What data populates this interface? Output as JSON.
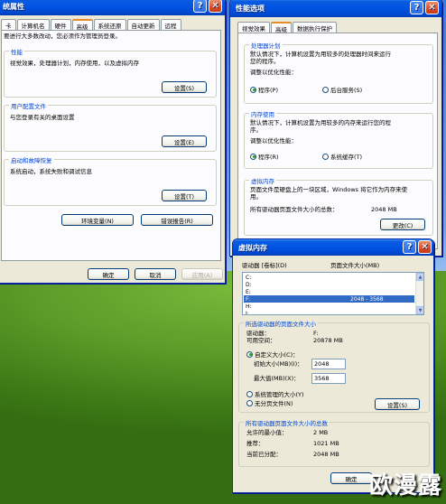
{
  "sysprops": {
    "title": "统属性",
    "help_btn": "?",
    "close_btn": "✕",
    "tabs": [
      "卡",
      "计算机名",
      "硬件",
      "高级",
      "系统还原",
      "自动更新",
      "远程"
    ],
    "admin_note": "要进行大多数改动，您必须作为管理员登录。",
    "performance": {
      "legend": "性能",
      "desc": "视觉效果，处理器计划，内存使用，以及虚拟内存",
      "btn": "设置(S)"
    },
    "profile": {
      "legend": "用户配置文件",
      "desc": "与您登录有关的桌面设置",
      "btn": "设置(E)"
    },
    "startup": {
      "legend": "启动和故障恢复",
      "desc": "系统启动，系统失败和调试信息",
      "btn": "设置(T)"
    },
    "env_btn": "环境变量(N)",
    "error_btn": "错误报告(R)",
    "ok": "确定",
    "cancel": "取消",
    "apply": "应用(A)"
  },
  "perfopts": {
    "title": "性能选项",
    "help_btn": "?",
    "close_btn": "✕",
    "tabs": [
      "视觉效果",
      "高级",
      "数据执行保护"
    ],
    "cpu": {
      "legend": "处理器计划",
      "desc_line1": "默认情况下，计算机设置为用较多的处理器时间来运行",
      "desc_line2": "您的程序。",
      "adjust": "调整以优化性能：",
      "opt1": "程序(P)",
      "opt2": "后台服务(S)"
    },
    "mem": {
      "legend": "内存使用",
      "desc_line1": "默认情况下，计算机设置为用较多的内存来运行您的程",
      "desc_line2": "序。",
      "adjust": "调整以优化性能：",
      "opt1": "程序(R)",
      "opt2": "系统缓存(T)"
    },
    "vm": {
      "legend": "虚拟内存",
      "desc_line1": "页面文件是硬盘上的一块区域，Windows 将它作为内存来使",
      "desc_line2": "用。",
      "total_label": "所有驱动器页面文件大小的总数：",
      "total_value": "2048 MB",
      "change_btn": "更改(C)"
    }
  },
  "vmdialog": {
    "title": "虚拟内存",
    "help_btn": "?",
    "close_btn": "✕",
    "col_drive": "驱动器 [卷标](D)",
    "col_size": "页面文件大小(MB)",
    "drives": [
      {
        "drive": "C:",
        "size": ""
      },
      {
        "drive": "D:",
        "size": ""
      },
      {
        "drive": "E:",
        "size": ""
      },
      {
        "drive": "F:",
        "size": "2048 - 3568"
      },
      {
        "drive": "H:",
        "size": ""
      },
      {
        "drive": "I:",
        "size": ""
      }
    ],
    "selected": {
      "legend": "所选驱动器的页面文件大小",
      "drive_label": "驱动器：",
      "drive_value": "F:",
      "space_label": "可用空间：",
      "space_value": "20878 MB"
    },
    "custom_label": "自定义大小(C)：",
    "initial_label": "初始大小(MB)(I)：",
    "initial_value": "2048",
    "max_label": "最大值(MB)(X)：",
    "max_value": "3568",
    "system_managed": "系统管理的大小(Y)",
    "no_paging": "无分页文件(N)",
    "set_btn": "设置(S)",
    "totals": {
      "legend": "所有驱动器页面文件大小的总数",
      "min_label": "允许的最小值：",
      "min_value": "2 MB",
      "rec_label": "推荐：",
      "rec_value": "1021 MB",
      "cur_label": "当前已分配：",
      "cur_value": "2048 MB"
    },
    "ok": "确定"
  },
  "watermark": "欧漫露"
}
